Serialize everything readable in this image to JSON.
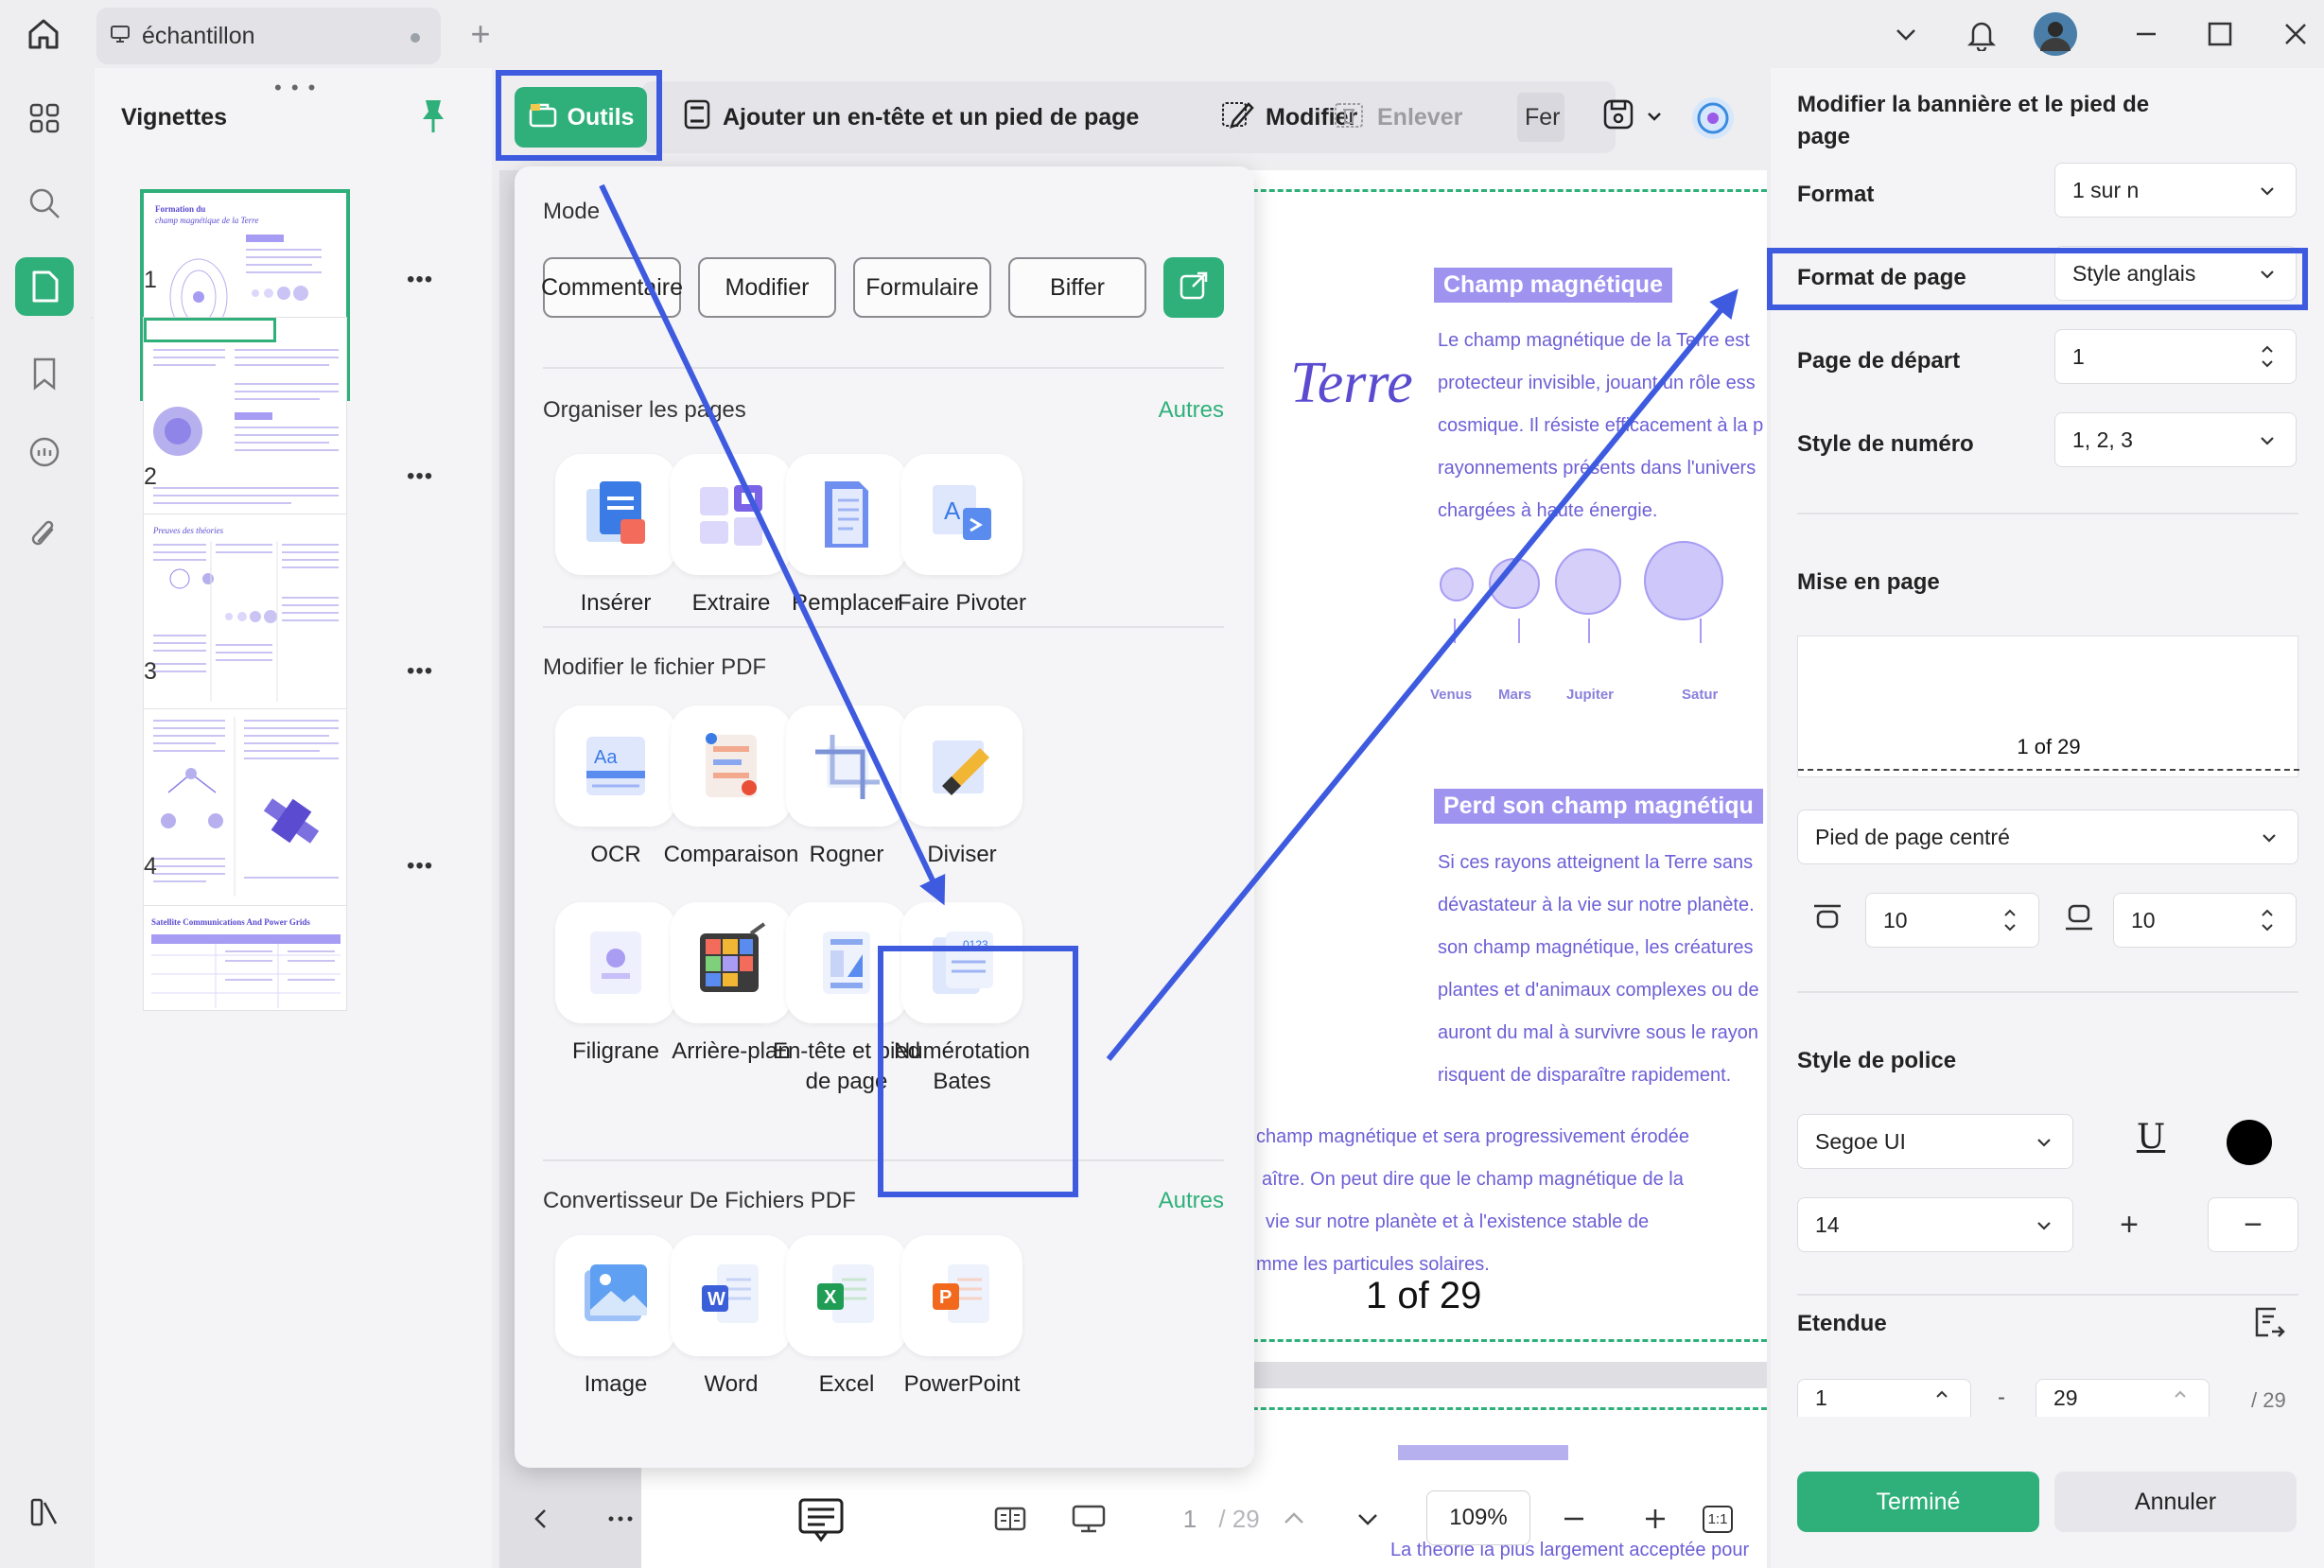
{
  "titlebar": {
    "tab_name": "échantillon",
    "add_tab": "+"
  },
  "thumbnails": {
    "title": "Vignettes",
    "grip": "• • •",
    "pages": [
      {
        "label": "1",
        "more": "•••"
      },
      {
        "label": "2",
        "more": "•••"
      },
      {
        "label": "3",
        "more": "•••"
      },
      {
        "label": "4",
        "more": "•••"
      }
    ],
    "thumb1_title": "Formation du",
    "thumb1_subtitle": "champ magnétique de la Terre",
    "thumb3_title": "Preuves des théories",
    "thumb5_title": "Satellite Communications And Power Grids"
  },
  "toolbar": {
    "outils": "Outils",
    "header_footer": "Ajouter un en-tête et un pied de page",
    "modify": "Modifier",
    "remove": "Enlever",
    "close_partial": "Fer"
  },
  "dropdown": {
    "mode_title": "Mode",
    "modes": [
      "Commentaire",
      "Modifier",
      "Formulaire",
      "Biffer"
    ],
    "organize_title": "Organiser les pages",
    "organize_more": "Autres",
    "organize_items": [
      "Insérer",
      "Extraire",
      "Remplacer",
      "Faire Pivoter"
    ],
    "modify_title": "Modifier le fichier PDF",
    "modify_items": [
      "OCR",
      "Comparaison",
      "Rogner",
      "Diviser",
      "Filigrane",
      "Arrière-plan",
      "En-tête et pied de page",
      "Numérotation Bates"
    ],
    "convert_title": "Convertisseur De Fichiers PDF",
    "convert_more": "Autres",
    "convert_items": [
      "Image",
      "Word",
      "Excel",
      "PowerPoint"
    ]
  },
  "document": {
    "heading1": "Champ magnétique",
    "para1": [
      "Le champ magnétique de la Terre est",
      "protecteur invisible, jouant un rôle ess",
      "cosmique. Il résiste efficacement à la p",
      "rayonnements présents dans l'univers",
      "chargées à haute énergie."
    ],
    "terre": "Terre",
    "planets": [
      "Venus",
      "Mars",
      "Jupiter",
      "Satur"
    ],
    "heading2": "Perd son champ magnétiqu",
    "para2": [
      "Si ces rayons atteignent la Terre sans",
      "dévastateur à la vie sur notre planète.",
      "son champ magnétique, les créatures",
      "plantes et d'animaux complexes ou de",
      "auront du mal à survivre sous le rayon",
      "risquent de disparaître rapidement."
    ],
    "para3": [
      "champ magnétique et sera progressivement érodée",
      "aître. On peut dire que le champ magnétique de la",
      "vie sur notre planète et à l'existence stable de",
      "mme les particules solaires."
    ],
    "page_number": "1 of 29",
    "footer_partial": "La théorie la plus largement acceptée pour"
  },
  "bottombar": {
    "page_current": "1",
    "page_total": "/ 29",
    "zoom": "109%",
    "fit": "1:1"
  },
  "panel": {
    "title": "Modifier la bannière et le pied de page",
    "format_label": "Format",
    "format_value": "1 sur n",
    "page_format_label": "Format de page",
    "page_format_value": "Style anglais",
    "start_page_label": "Page de départ",
    "start_page_value": "1",
    "number_style_label": "Style de numéro",
    "number_style_value": "1, 2, 3",
    "layout_label": "Mise en page",
    "preview_text": "1 of 29",
    "position_value": "Pied de page centré",
    "margin_top": "10",
    "margin_bottom": "10",
    "font_style_label": "Style de police",
    "font_value": "Segoe UI",
    "underline_glyph": "U",
    "font_size_value": "14",
    "plus": "+",
    "minus": "−",
    "range_label": "Etendue",
    "range_from": "1",
    "range_dash": "-",
    "range_to": "29",
    "range_total": "/ 29",
    "done": "Terminé",
    "cancel": "Annuler"
  },
  "colors": {
    "accent": "#2fb07a",
    "highlight": "#3e5be0",
    "doc_purple": "#6c5fd6"
  }
}
